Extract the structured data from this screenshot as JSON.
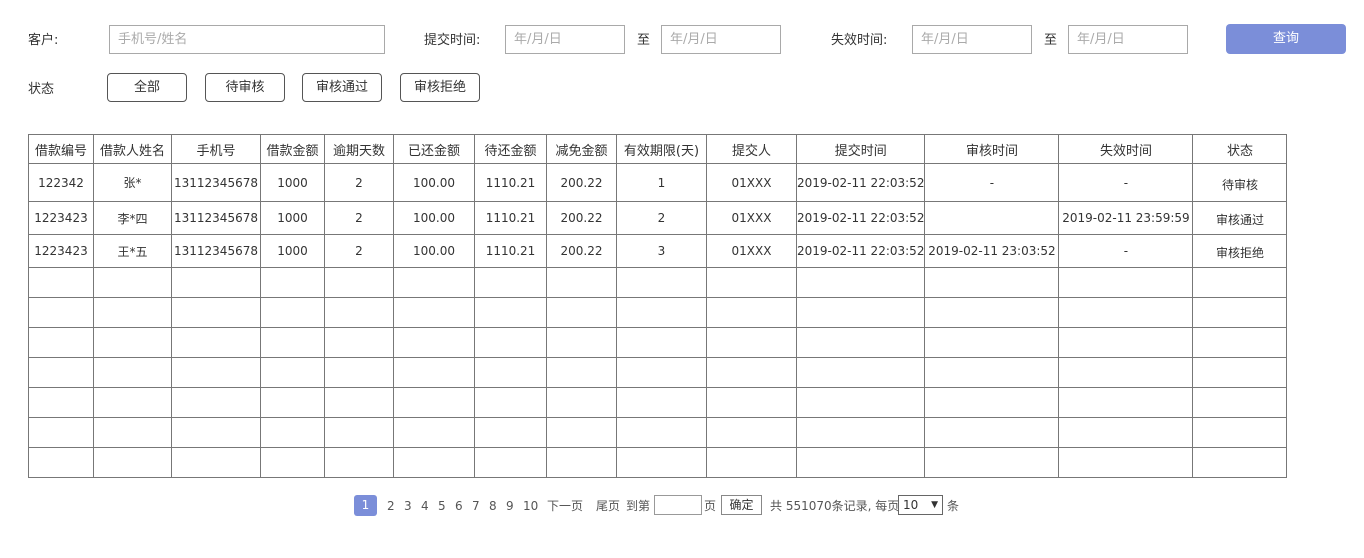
{
  "filters": {
    "customer_label": "客户:",
    "customer_placeholder": "手机号/姓名",
    "submit_time_label": "提交时间:",
    "expire_time_label": "失效时间:",
    "date_placeholder": "年/月/日",
    "to_label": "至",
    "query_button": "查询",
    "status_label": "状态",
    "status_buttons": [
      "全部",
      "待审核",
      "审核通过",
      "审核拒绝"
    ]
  },
  "table": {
    "headers": [
      "借款编号",
      "借款人姓名",
      "手机号",
      "借款金额",
      "逾期天数",
      "已还金额",
      "待还金额",
      "减免金额",
      "有效期限(天)",
      "提交人",
      "提交时间",
      "审核时间",
      "失效时间",
      "状态"
    ],
    "rows": [
      [
        "122342",
        "张*",
        "13112345678",
        "1000",
        "2",
        "100.00",
        "1110.21",
        "200.22",
        "1",
        "01XXX",
        "2019-02-11 22:03:52",
        "-",
        "-",
        "待审核"
      ],
      [
        "1223423",
        "李*四",
        "13112345678",
        "1000",
        "2",
        "100.00",
        "1110.21",
        "200.22",
        "2",
        "01XXX",
        "2019-02-11 22:03:52",
        "",
        "2019-02-11 23:59:59",
        "审核通过"
      ],
      [
        "1223423",
        "王*五",
        "13112345678",
        "1000",
        "2",
        "100.00",
        "1110.21",
        "200.22",
        "3",
        "01XXX",
        "2019-02-11 22:03:52",
        "2019-02-11 23:03:52",
        "-",
        "审核拒绝"
      ]
    ]
  },
  "pagination": {
    "current": "1",
    "pages": [
      "2",
      "3",
      "4",
      "5",
      "6",
      "7",
      "8",
      "9",
      "10"
    ],
    "next": "下一页",
    "last": "尾页",
    "goto_label": "到第",
    "page_unit": "页",
    "confirm": "确定",
    "total_text": "共 551070条记录, 每页",
    "page_size": "10",
    "per_unit": "条"
  },
  "colors": {
    "accent": "#7b8ed9",
    "border": "#777777",
    "text": "#333333"
  }
}
